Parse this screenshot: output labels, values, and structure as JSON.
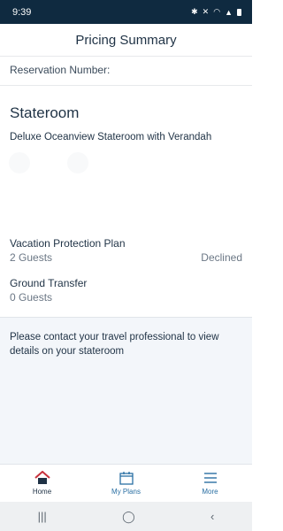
{
  "status_bar": {
    "time": "9:39"
  },
  "header": {
    "title": "Pricing Summary"
  },
  "reservation": {
    "label": "Reservation Number:"
  },
  "stateroom": {
    "title": "Stateroom",
    "description": "Deluxe Oceanview Stateroom with Verandah"
  },
  "protection_plan": {
    "title": "Vacation Protection Plan",
    "guests": "2 Guests",
    "status": "Declined"
  },
  "ground_transfer": {
    "title": "Ground Transfer",
    "guests": "0 Guests"
  },
  "info": {
    "message": "Please contact your travel professional to view details on your stateroom"
  },
  "tabs": [
    {
      "label": "Home",
      "icon": "home-icon"
    },
    {
      "label": "My Plans",
      "icon": "calendar-icon"
    },
    {
      "label": "More",
      "icon": "menu-icon"
    }
  ],
  "colors": {
    "status_bar": "#0f2a40",
    "accent": "#2a6fa3",
    "home_icon": "#c8323c",
    "panel": "#f3f6fa"
  }
}
